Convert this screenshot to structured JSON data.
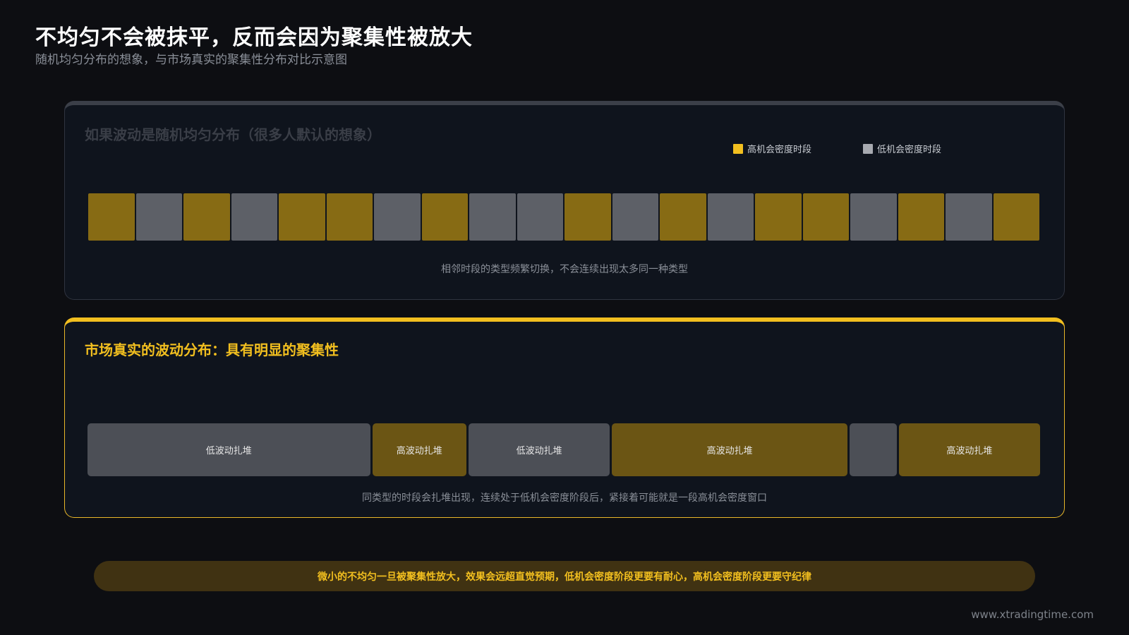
{
  "header": {
    "title": "不均匀不会被抹平，反而会因为聚集性被放大",
    "subtitle": "随机均匀分布的想象，与市场真实的聚集性分布对比示意图"
  },
  "random_panel": {
    "title": "如果波动是随机均匀分布（很多人默认的想象）",
    "legend": [
      {
        "label": "高机会密度时段",
        "color": "#f2bf1f"
      },
      {
        "label": "低机会密度时段",
        "color": "#a7aab0"
      }
    ],
    "blocks": [
      "high",
      "low",
      "high",
      "low",
      "high",
      "high",
      "low",
      "high",
      "low",
      "low",
      "high",
      "low",
      "high",
      "low",
      "high",
      "high",
      "low",
      "high",
      "low",
      "high"
    ],
    "caption": "相邻时段的类型频繁切换，不会连续出现太多同一种类型"
  },
  "real_panel": {
    "title": "市场真实的波动分布：具有明显的聚集性",
    "segments": [
      {
        "type": "low",
        "label": "低波动扎堆",
        "weight": 6
      },
      {
        "type": "high",
        "label": "高波动扎堆",
        "weight": 2
      },
      {
        "type": "low",
        "label": "低波动扎堆",
        "weight": 3
      },
      {
        "type": "high",
        "label": "高波动扎堆",
        "weight": 5
      },
      {
        "type": "low",
        "label": "",
        "weight": 1
      },
      {
        "type": "high",
        "label": "高波动扎堆",
        "weight": 3
      }
    ],
    "caption": "同类型的时段会扎堆出现，连续处于低机会密度阶段后，紧接着可能就是一段高机会密度窗口"
  },
  "conclusion": "微小的不均匀一旦被聚集性放大，效果会远超直觉预期，低机会密度阶段更要有耐心，高机会密度阶段更要守纪律",
  "watermark": "www.xtradingtime.com",
  "colors": {
    "accent": "#f2bf1f",
    "high_block": "#876b14",
    "low_block": "#5d6067",
    "background": "#0d0e12"
  }
}
